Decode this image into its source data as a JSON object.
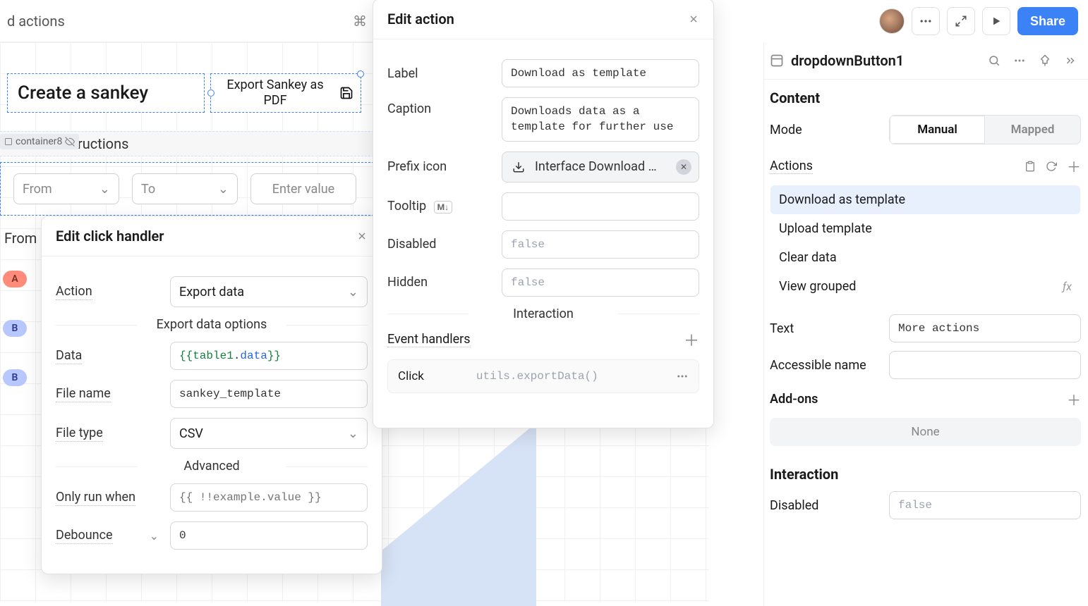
{
  "topbar": {
    "left_text": "d actions",
    "shortcut_hint": "⌘",
    "share_label": "Share"
  },
  "canvas": {
    "title": "Create a sankey",
    "export_btn": "Export Sankey as PDF",
    "instructions_text": "ructions",
    "container_tag": "container8",
    "from_placeholder": "From",
    "to_placeholder": "To",
    "value_placeholder": "Enter value",
    "from_header": "From",
    "badges": {
      "a": "A",
      "b1": "B",
      "b2": "B"
    }
  },
  "click_panel": {
    "title": "Edit click handler",
    "action_label": "Action",
    "action_value": "Export data",
    "options_title": "Export data options",
    "data_label": "Data",
    "data_expr_open": "{{",
    "data_expr_obj": "table1",
    "data_expr_dot": ".",
    "data_expr_prop": "data",
    "data_expr_close": "}}",
    "filename_label": "File name",
    "filename_value": "sankey_template",
    "filetype_label": "File type",
    "filetype_value": "CSV",
    "advanced_title": "Advanced",
    "onlyrun_label": "Only run when",
    "onlyrun_placeholder": "{{ !!example.value }}",
    "debounce_label": "Debounce",
    "debounce_value": "0"
  },
  "action_panel": {
    "title": "Edit action",
    "label_label": "Label",
    "label_value": "Download as template",
    "caption_label": "Caption",
    "caption_value": "Downloads data as a template for further use",
    "prefix_label": "Prefix icon",
    "prefix_value": "Interface Download …",
    "tooltip_label": "Tooltip",
    "disabled_label": "Disabled",
    "disabled_value": "false",
    "hidden_label": "Hidden",
    "hidden_value": "false",
    "interaction_title": "Interaction",
    "event_handlers_label": "Event handlers",
    "event_click": "Click",
    "event_code": "utils.exportData()"
  },
  "inspector": {
    "component_name": "dropdownButton1",
    "content_title": "Content",
    "mode_label": "Mode",
    "mode_manual": "Manual",
    "mode_mapped": "Mapped",
    "actions_label": "Actions",
    "actions": [
      {
        "label": "Download as template",
        "selected": true
      },
      {
        "label": "Upload template",
        "selected": false
      },
      {
        "label": "Clear data",
        "selected": false
      },
      {
        "label": "View grouped",
        "selected": false,
        "fx": true
      }
    ],
    "text_label": "Text",
    "text_value": "More actions",
    "accessible_label": "Accessible name",
    "addons_label": "Add-ons",
    "addons_none": "None",
    "interaction_title": "Interaction",
    "disabled_label": "Disabled",
    "disabled_value": "false"
  }
}
